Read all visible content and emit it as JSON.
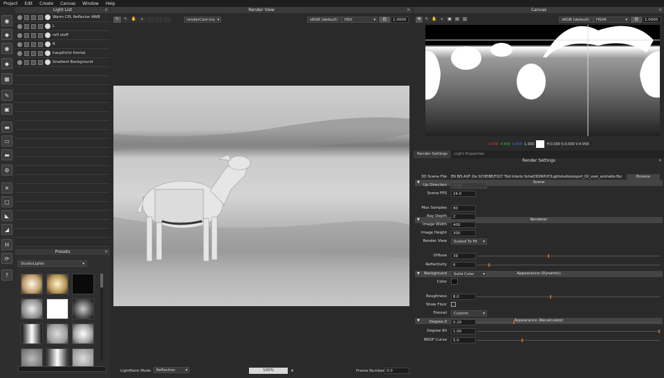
{
  "menu": [
    "Project",
    "Edit",
    "Create",
    "Canvas",
    "Window",
    "Help"
  ],
  "light_list": {
    "title": "Light List",
    "items": [
      "Warm CPL Reflector AWB",
      "L",
      "refl stoff",
      "R",
      "hauptlicht frontal",
      "Gradient Background"
    ]
  },
  "presets": {
    "title": "Presets",
    "selected": "StudioLights"
  },
  "render_view": {
    "title": "Render View",
    "camera": "renderCam-Ins",
    "colorspace": "sRGB (default)",
    "mode": "HSV",
    "exposure": "1.0000",
    "lightpaint_label": "LightPaint Mode",
    "lightpaint_value": "Reflection",
    "progress": "100%",
    "progress_fraction": 1.0,
    "frame_label": "Frame Number",
    "frame_value": "0.0"
  },
  "canvas": {
    "title": "Canvas",
    "colorspace": "sRGB (default)",
    "mode": "HSVA",
    "exposure": "1.0000",
    "r": "4.958",
    "g": "4.958",
    "b": "4.958",
    "a": "1.000",
    "hsv": "H:0.000 S:0.000 V:4.958"
  },
  "settings": {
    "tabs": [
      "Render Settings",
      "Light Properties"
    ],
    "title": "Render Settings",
    "scene_header": "Scene",
    "scene_file_label": "3D Scene File",
    "scene_file_value": "EN BIS AUF 2te SCHEIBE/F027 Tbd Interio Schaf/3DINPUT/Lightstudio/export_02_voor_animatie.fbx",
    "browse": "Browse",
    "up_label": "Up Direction",
    "up_value": "Y-Up",
    "fps_label": "Scene FPS",
    "fps_value": "24.0",
    "renderer_header": "Renderer",
    "samples_label": "Max Samples",
    "samples_value": "80",
    "depth_label": "Ray Depth",
    "depth_value": "2",
    "width_label": "Image Width",
    "width_value": "400",
    "height_label": "Image Height",
    "height_value": "300",
    "rview_label": "Render View",
    "rview_value": "Scaled To Fit",
    "app_dyn_header": "Appearance (Dynamic)",
    "diffuse_label": "Diffuse",
    "diffuse_value": "39",
    "refl_label": "Reflectivity",
    "refl_value": "6",
    "bg_label": "Background",
    "bg_value": "Solid Color",
    "color_label": "Color",
    "app_rec_header": "Appearance (Recalculate)",
    "rough_label": "Roughness",
    "rough_value": "8.0",
    "floor_label": "Show Floor",
    "fresnel_label": "Fresnel",
    "fresnel_value": "Custom",
    "deg0_label": "Degree 0",
    "deg0_value": "0.20",
    "deg90_label": "Degree 90",
    "deg90_value": "1.00",
    "brdf_label": "BRDF Curve",
    "brdf_value": "5.0"
  }
}
